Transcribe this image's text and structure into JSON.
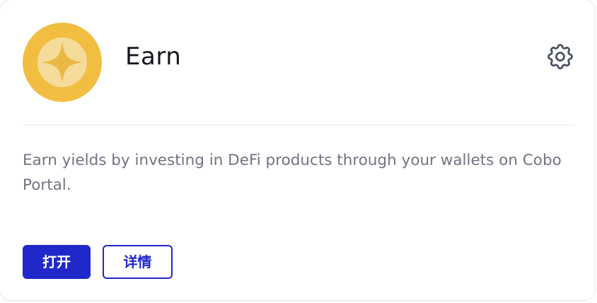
{
  "card": {
    "title": "Earn",
    "description": "Earn yields by investing in DeFi products through your wallets on Cobo Portal.",
    "open_label": "打开",
    "details_label": "详情",
    "logo_icon": "sparkle-star-icon",
    "settings_icon": "gear-icon"
  },
  "colors": {
    "primary": "#2128c9",
    "logo_gold": "#f1be42",
    "text_muted": "#6f7480"
  }
}
